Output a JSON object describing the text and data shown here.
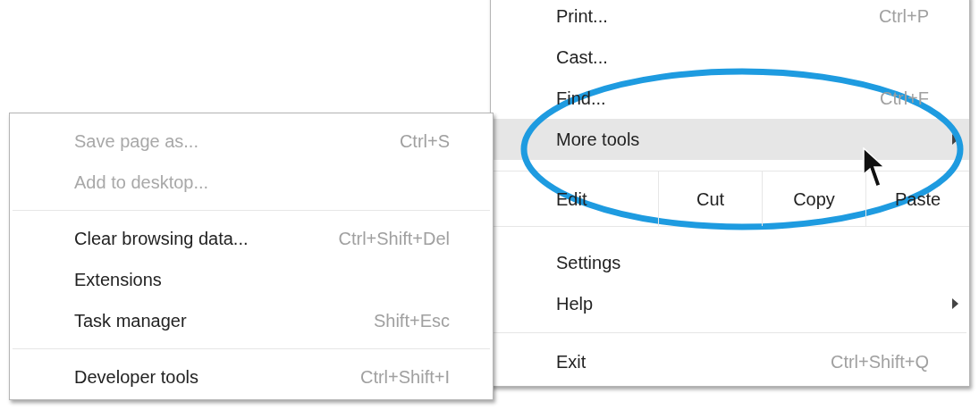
{
  "main_menu": {
    "items": [
      {
        "kind": "item",
        "label": "Print...",
        "shortcut": "Ctrl+P",
        "selected": false
      },
      {
        "kind": "item",
        "label": "Cast...",
        "selected": false
      },
      {
        "kind": "item",
        "label": "Find...",
        "shortcut": "Ctrl+F",
        "selected": false
      },
      {
        "kind": "submenu",
        "label": "More tools",
        "selected": true
      },
      {
        "kind": "edit",
        "label": "Edit",
        "buttons": [
          "Cut",
          "Copy",
          "Paste"
        ]
      },
      {
        "kind": "item",
        "label": "Settings",
        "selected": false
      },
      {
        "kind": "submenu",
        "label": "Help",
        "selected": false
      },
      {
        "kind": "divider"
      },
      {
        "kind": "item",
        "label": "Exit",
        "shortcut": "Ctrl+Shift+Q",
        "selected": false
      }
    ]
  },
  "submenu": {
    "items": [
      {
        "kind": "item",
        "label": "Save page as...",
        "shortcut": "Ctrl+S",
        "disabled": true
      },
      {
        "kind": "item",
        "label": "Add to desktop...",
        "disabled": true
      },
      {
        "kind": "divider"
      },
      {
        "kind": "item",
        "label": "Clear browsing data...",
        "shortcut": "Ctrl+Shift+Del",
        "disabled": false
      },
      {
        "kind": "item",
        "label": "Extensions",
        "disabled": false
      },
      {
        "kind": "item",
        "label": "Task manager",
        "shortcut": "Shift+Esc",
        "disabled": false
      },
      {
        "kind": "divider"
      },
      {
        "kind": "item",
        "label": "Developer tools",
        "shortcut": "Ctrl+Shift+I",
        "disabled": false
      }
    ]
  }
}
